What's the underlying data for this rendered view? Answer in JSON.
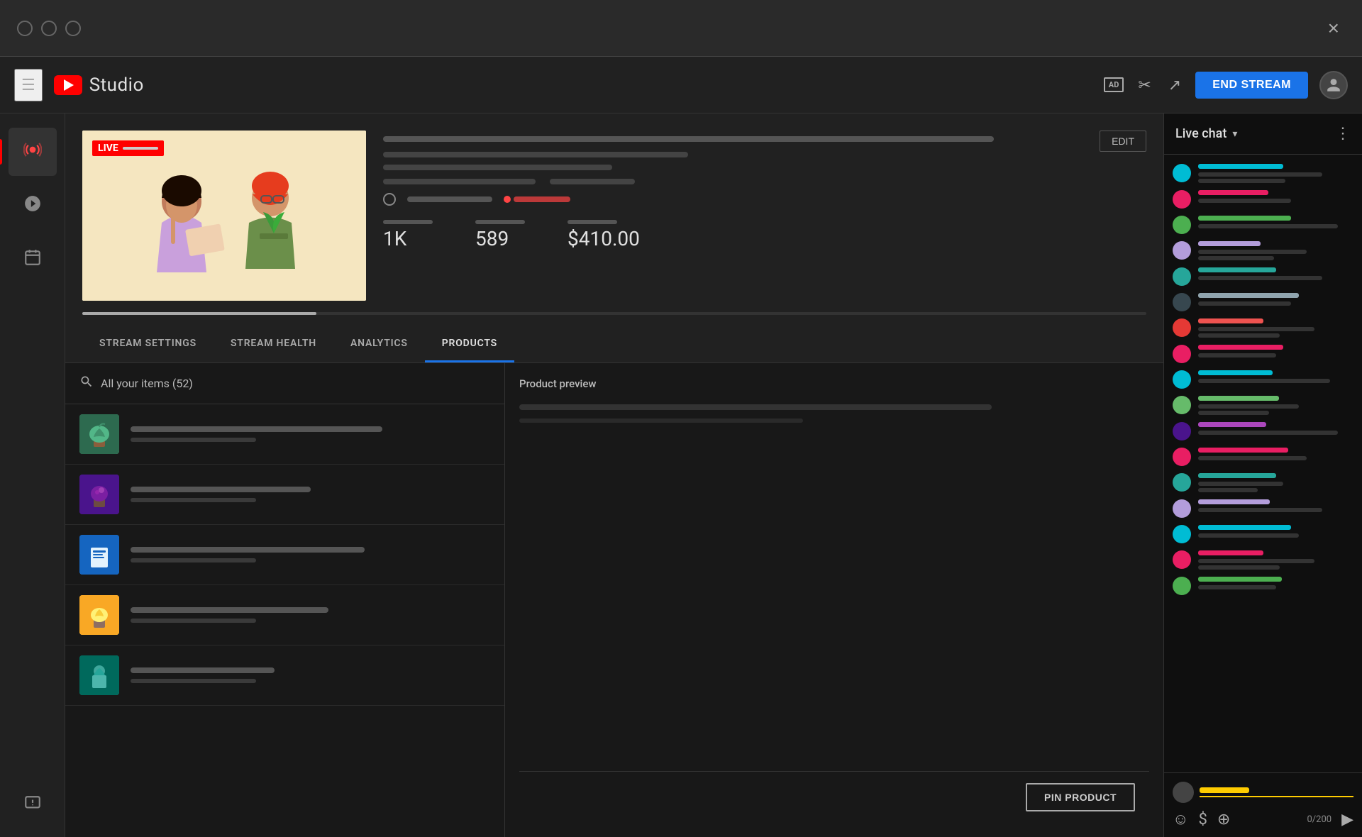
{
  "window": {
    "title": "YouTube Studio",
    "close_label": "×"
  },
  "topbar": {
    "logo_text": "Studio",
    "ad_badge": "AD",
    "end_stream_label": "END STREAM",
    "actions": {
      "scissors_icon": "scissors",
      "share_icon": "share",
      "account_icon": "account"
    }
  },
  "sidebar": {
    "items": [
      {
        "id": "live",
        "icon": "📡",
        "label": "Live",
        "active": true
      },
      {
        "id": "camera",
        "icon": "📷",
        "label": "Camera"
      },
      {
        "id": "calendar",
        "icon": "📅",
        "label": "Calendar"
      }
    ],
    "bottom_items": [
      {
        "id": "feedback",
        "icon": "!",
        "label": "Feedback"
      }
    ]
  },
  "stream": {
    "live_badge": "LIVE",
    "edit_button": "EDIT",
    "stats": {
      "viewers": "1K",
      "likes": "589",
      "revenue": "$410.00"
    }
  },
  "tabs": [
    {
      "id": "stream_settings",
      "label": "STREAM SETTINGS",
      "active": false
    },
    {
      "id": "stream_health",
      "label": "STREAM HEALTH",
      "active": false
    },
    {
      "id": "analytics",
      "label": "ANALYTICS",
      "active": false
    },
    {
      "id": "products",
      "label": "PRODUCTS",
      "active": true
    }
  ],
  "products": {
    "search_placeholder": "All your items (52)",
    "search_label": "All your items (52)",
    "items": [
      {
        "color": "green",
        "name_width": "70%"
      },
      {
        "color": "purple",
        "name_width": "50%"
      },
      {
        "color": "blue",
        "name_width": "65%"
      },
      {
        "color": "yellow",
        "name_width": "55%"
      },
      {
        "color": "teal",
        "name_width": "40%"
      }
    ],
    "preview": {
      "title": "Product preview",
      "pin_button": "PIN PRODUCT"
    }
  },
  "chat": {
    "title": "Live chat",
    "dropdown_icon": "▾",
    "more_icon": "⋮",
    "input_placeholder": "",
    "char_count": "0/200",
    "messages": [
      {
        "avatar_color": "#00bcd4",
        "username_width": "55%",
        "username_color": "#00bcd4",
        "text_width": "80%"
      },
      {
        "avatar_color": "#e91e63",
        "username_width": "45%",
        "username_color": "#e91e63",
        "text_width": "60%"
      },
      {
        "avatar_color": "#4caf50",
        "username_width": "60%",
        "username_color": "#4caf50",
        "text_width": "90%"
      },
      {
        "avatar_color": "#b39ddb",
        "username_width": "40%",
        "username_color": "#b39ddb",
        "text_width": "70%"
      },
      {
        "avatar_color": "#26a69a",
        "username_width": "50%",
        "username_color": "#26a69a",
        "text_width": "80%"
      },
      {
        "avatar_color": "#37474f",
        "username_width": "65%",
        "username_color": "#90a4ae",
        "text_width": "60%"
      },
      {
        "avatar_color": "#e53935",
        "username_width": "42%",
        "username_color": "#ef5350",
        "text_width": "75%"
      },
      {
        "avatar_color": "#e91e63",
        "username_width": "55%",
        "username_color": "#e91e63",
        "text_width": "50%"
      },
      {
        "avatar_color": "#00bcd4",
        "username_width": "48%",
        "username_color": "#00bcd4",
        "text_width": "85%"
      },
      {
        "avatar_color": "#66bb6a",
        "username_width": "52%",
        "username_color": "#66bb6a",
        "text_width": "65%"
      },
      {
        "avatar_color": "#4a148c",
        "username_width": "44%",
        "username_color": "#ab47bc",
        "text_width": "90%"
      },
      {
        "avatar_color": "#e91e63",
        "username_width": "58%",
        "username_color": "#e91e63",
        "text_width": "70%"
      },
      {
        "avatar_color": "#26a69a",
        "username_width": "50%",
        "username_color": "#26a69a",
        "text_width": "55%"
      },
      {
        "avatar_color": "#b39ddb",
        "username_width": "46%",
        "username_color": "#b39ddb",
        "text_width": "80%"
      },
      {
        "avatar_color": "#00bcd4",
        "username_width": "60%",
        "username_color": "#00bcd4",
        "text_width": "65%"
      },
      {
        "avatar_color": "#e91e63",
        "username_width": "42%",
        "username_color": "#e91e63",
        "text_width": "75%"
      },
      {
        "avatar_color": "#4caf50",
        "username_width": "54%",
        "username_color": "#4caf50",
        "text_width": "50%"
      }
    ]
  }
}
